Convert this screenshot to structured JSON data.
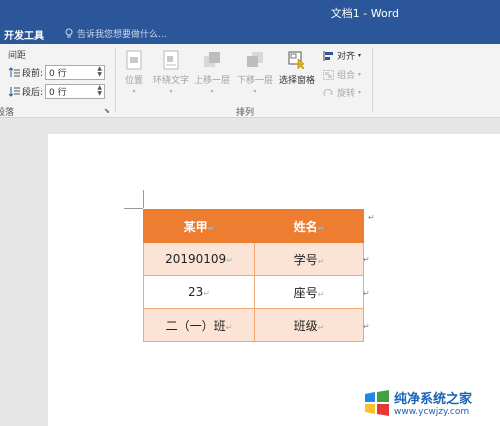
{
  "window": {
    "title": "文档1 - Word"
  },
  "tabs": {
    "developer": "开发工具"
  },
  "tellme": {
    "placeholder": "告诉我您想要做什么..."
  },
  "paragraph_group": {
    "spacing_label": "间距",
    "before_label": "段前:",
    "before_value": "0 行",
    "after_label": "段后:",
    "after_value": "0 行",
    "group_label": "段落"
  },
  "arrange_group": {
    "buttons": {
      "position": "位置",
      "wrap_text": "环绕文字",
      "bring_forward": "上移一层",
      "send_backward": "下移一层",
      "selection_pane": "选择窗格",
      "align": "对齐",
      "group": "组合",
      "rotate": "旋转"
    },
    "group_label": "排列"
  },
  "table": {
    "header": [
      "某甲",
      "姓名"
    ],
    "rows": [
      [
        "20190109",
        "学号"
      ],
      [
        "23",
        "座号"
      ],
      [
        "二（一）班",
        "班级"
      ]
    ],
    "header_color": "#ed7d31",
    "shade_color": "#fbe4d5"
  },
  "watermark": {
    "name": "纯净系统之家",
    "url": "www.ycwjzy.com"
  }
}
